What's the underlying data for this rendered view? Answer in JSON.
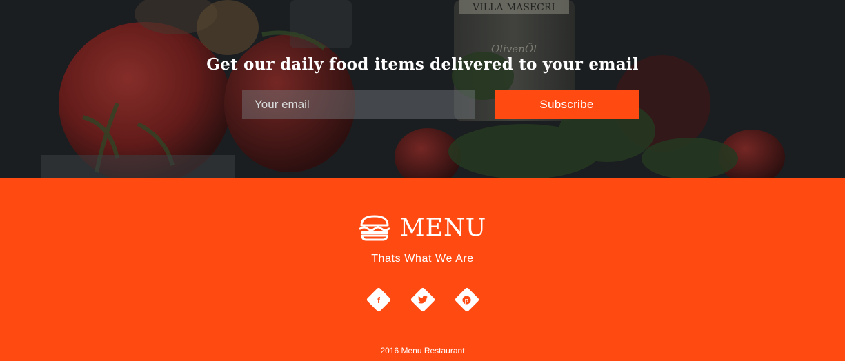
{
  "subscribe": {
    "heading": "Get our daily food items delivered to your email",
    "email_placeholder": "Your email",
    "button_label": "Subscribe",
    "bottle_brand": "VILLA MASECRI",
    "bottle_label": "OlivenÖl"
  },
  "footer": {
    "logo_text": "MENU",
    "tagline": "Thats What We Are",
    "social": [
      {
        "name": "facebook",
        "icon": "facebook-icon"
      },
      {
        "name": "twitter",
        "icon": "twitter-icon"
      },
      {
        "name": "pinterest",
        "icon": "pinterest-icon"
      }
    ],
    "copyright": "2016 Menu Restaurant"
  },
  "colors": {
    "accent": "#ff4a12",
    "overlay_dark": "#1e2124",
    "text_light": "#ffffff"
  }
}
